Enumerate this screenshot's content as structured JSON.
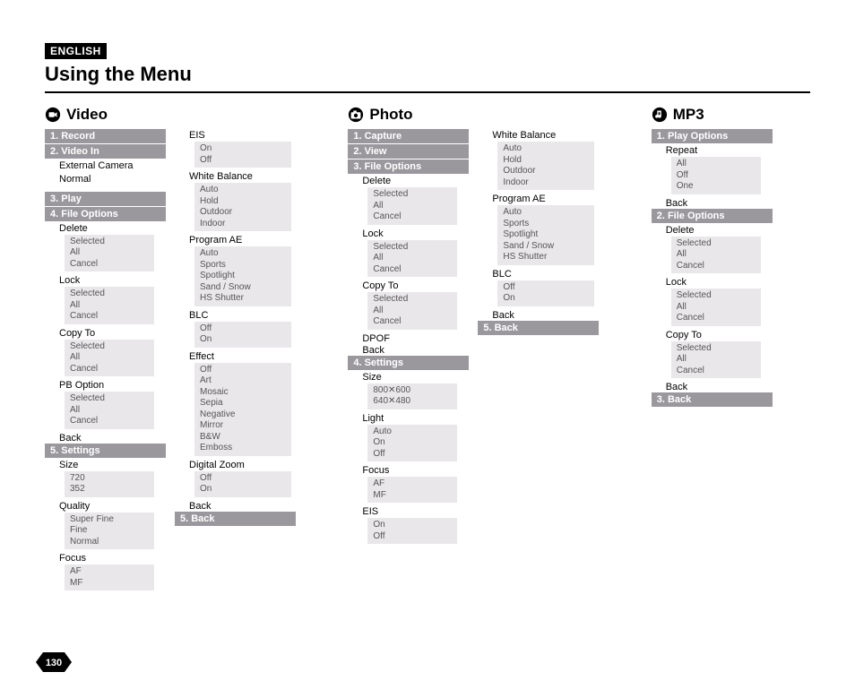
{
  "lang_badge": "ENGLISH",
  "page_title": "Using the Menu",
  "page_number": "130",
  "sections": {
    "video": {
      "title": "Video"
    },
    "photo": {
      "title": "Photo"
    },
    "mp3": {
      "title": "MP3"
    }
  },
  "video": {
    "col1": {
      "m1": "1. Record",
      "m2": "2. Video In",
      "m2_opts": [
        "External Camera",
        "Normal"
      ],
      "m3": "3. Play",
      "m4": "4. File Options",
      "delete": "Delete",
      "delete_opts": [
        "Selected",
        "All",
        "Cancel"
      ],
      "lock": "Lock",
      "lock_opts": [
        "Selected",
        "All",
        "Cancel"
      ],
      "copyto": "Copy To",
      "copyto_opts": [
        "Selected",
        "All",
        "Cancel"
      ],
      "pbopt": "PB Option",
      "pbopt_opts": [
        "Selected",
        "All",
        "Cancel"
      ],
      "back": "Back",
      "m5": "5. Settings",
      "size": "Size",
      "size_opts": [
        "720",
        "352"
      ],
      "quality": "Quality",
      "quality_opts": [
        "Super Fine",
        "Fine",
        "Normal"
      ],
      "focus": "Focus",
      "focus_opts": [
        "AF",
        "MF"
      ]
    },
    "col2": {
      "eis": "EIS",
      "eis_opts": [
        "On",
        "Off"
      ],
      "wb": "White Balance",
      "wb_opts": [
        "Auto",
        "Hold",
        "Outdoor",
        "Indoor"
      ],
      "pae": "Program AE",
      "pae_opts": [
        "Auto",
        "Sports",
        "Spotlight",
        "Sand / Snow",
        "HS Shutter"
      ],
      "blc": "BLC",
      "blc_opts": [
        "Off",
        "On"
      ],
      "effect": "Effect",
      "effect_opts": [
        "Off",
        "Art",
        "Mosaic",
        "Sepia",
        "Negative",
        "Mirror",
        "B&W",
        "Emboss"
      ],
      "dz": "Digital Zoom",
      "dz_opts": [
        "Off",
        "On"
      ],
      "back": "Back",
      "m5": "5. Back"
    }
  },
  "photo": {
    "col1": {
      "m1": "1. Capture",
      "m2": "2. View",
      "m3": "3. File Options",
      "delete": "Delete",
      "delete_opts": [
        "Selected",
        "All",
        "Cancel"
      ],
      "lock": "Lock",
      "lock_opts": [
        "Selected",
        "All",
        "Cancel"
      ],
      "copyto": "Copy To",
      "copyto_opts": [
        "Selected",
        "All",
        "Cancel"
      ],
      "dpof": "DPOF",
      "back": "Back",
      "m4": "4. Settings",
      "size": "Size",
      "size_opts": [
        "800✕600",
        "640✕480"
      ],
      "light": "Light",
      "light_opts": [
        "Auto",
        "On",
        "Off"
      ],
      "focus": "Focus",
      "focus_opts": [
        "AF",
        "MF"
      ],
      "eis": "EIS",
      "eis_opts": [
        "On",
        "Off"
      ]
    },
    "col2": {
      "wb": "White Balance",
      "wb_opts": [
        "Auto",
        "Hold",
        "Outdoor",
        "Indoor"
      ],
      "pae": "Program AE",
      "pae_opts": [
        "Auto",
        "Sports",
        "Spotlight",
        "Sand / Snow",
        "HS Shutter"
      ],
      "blc": "BLC",
      "blc_opts": [
        "Off",
        "On"
      ],
      "back": "Back",
      "m5": "5. Back"
    }
  },
  "mp3": {
    "m1": "1. Play Options",
    "repeat": "Repeat",
    "repeat_opts": [
      "All",
      "Off",
      "One"
    ],
    "back1": "Back",
    "m2": "2. File Options",
    "delete": "Delete",
    "delete_opts": [
      "Selected",
      "All",
      "Cancel"
    ],
    "lock": "Lock",
    "lock_opts": [
      "Selected",
      "All",
      "Cancel"
    ],
    "copyto": "Copy To",
    "copyto_opts": [
      "Selected",
      "All",
      "Cancel"
    ],
    "back2": "Back",
    "m3": "3. Back"
  }
}
